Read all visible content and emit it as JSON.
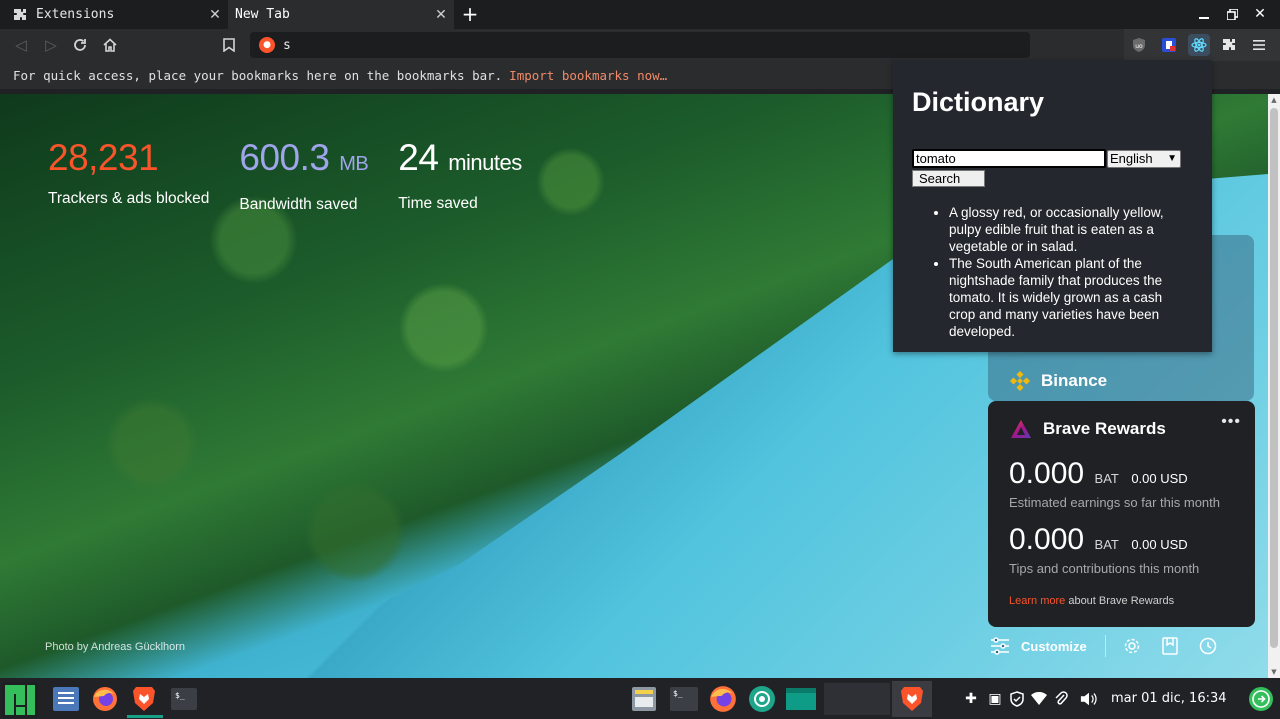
{
  "tabs": [
    {
      "label": "Extensions",
      "icon": "puzzle-icon"
    },
    {
      "label": "New Tab",
      "icon": "none"
    }
  ],
  "omnibox": {
    "value": "s",
    "icon": "duckduckgo-icon"
  },
  "bookmarks_bar": {
    "message": "For quick access, place your bookmarks here on the bookmarks bar.",
    "import_link": "Import bookmarks now…"
  },
  "stats": [
    {
      "value": "28,231",
      "unit": "",
      "caption": "Trackers & ads blocked",
      "color": "#fb542b"
    },
    {
      "value": "600.3",
      "unit": "MB",
      "caption": "Bandwidth saved",
      "color": "#a0a5eb"
    },
    {
      "value": "24",
      "unit": "minutes",
      "caption": "Time saved",
      "color": "#ffffff"
    }
  ],
  "photo_credit": "Photo by Andreas Gücklhorn",
  "binance": {
    "label": "Binance"
  },
  "rewards": {
    "title": "Brave Rewards",
    "more": "•••",
    "earnings": {
      "amount": "0.000",
      "currency": "BAT",
      "usd": "0.00 USD",
      "caption": "Estimated earnings so far this month"
    },
    "tips": {
      "amount": "0.000",
      "currency": "BAT",
      "usd": "0.00 USD",
      "caption": "Tips and contributions this month"
    },
    "learn_more": "Learn more",
    "learn_more_suffix": "about Brave Rewards"
  },
  "footer": {
    "customize": "Customize"
  },
  "dictionary": {
    "title": "Dictionary",
    "query": "tomato",
    "language": "English",
    "search_button": "Search",
    "definitions": [
      "A glossy red, or occasionally yellow, pulpy edible fruit that is eaten as a vegetable or in salad.",
      "The South American plant of the nightshade family that produces the tomato. It is widely grown as a cash crop and many varieties have been developed."
    ]
  },
  "taskbar": {
    "clock": "mar 01 dic, 16:34"
  },
  "colors": {
    "brave_orange": "#fb542b",
    "accent_green": "#19a187"
  }
}
